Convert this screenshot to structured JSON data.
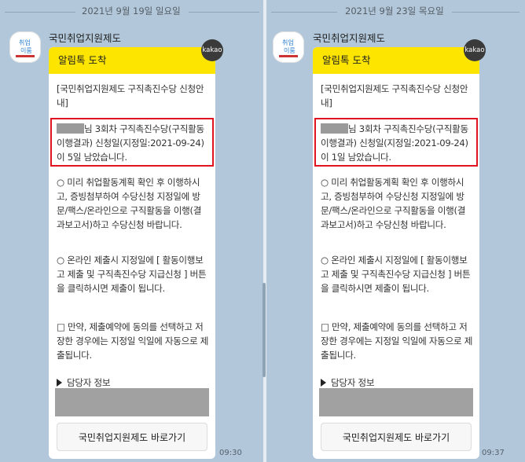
{
  "left": {
    "date": "2021년 9월 19일 일요일",
    "sender": "국민취업지원제도",
    "header": "알림톡 도착",
    "badge": "kakao",
    "intro": "[국민취업지원제도 구직촉진수당 신청안내]",
    "notice_suffix": "님 3회차 구직촉진수당(구직활동이행결과) 신청일(지정일:2021-09-24)이 5일 남았습니다.",
    "para1": "○ 미리 취업활동계획 확인 후 이행하시고, 증빙첨부하여 수당신청 지정일에 방문/팩스/온라인으로  구직활동을 이행(결과보고서)하고 수당신청 바랍니다.",
    "para2": "○ 온라인 제출시 지정일에 [ 활동이행보고 제출 및 구직촉진수당 지급신청 ] 버튼을 클릭하시면 제출이 됩니다.",
    "para3": "□ 만약, 제출예약에 동의를 선택하고 저장한 경우에는 지정일 익일에 자동으로 제출됩니다.",
    "staff": "담당자 정보",
    "button": "국민취업지원제도 바로가기",
    "time": "09:30"
  },
  "right": {
    "date": "2021년 9월 23일 목요일",
    "sender": "국민취업지원제도",
    "header": "알림톡 도착",
    "badge": "kakao",
    "intro": "[국민취업지원제도 구직촉진수당 신청안내]",
    "notice_suffix": "님 3회차 구직촉진수당(구직활동이행결과) 신청일(지정일:2021-09-24)이 1일 남았습니다.",
    "para1": "○ 미리 취업활동계획 확인 후 이행하시고, 증빙첨부하여 수당신청 지정일에 방문/팩스/온라인으로  구직활동을 이행(결과보고서)하고 수당신청 바랍니다.",
    "para2": "○ 온라인 제출시 지정일에 [ 활동이행보고 제출 및 구직촉진수당 지급신청 ] 버튼을 클릭하시면 제출이 됩니다.",
    "para3": "□ 만약, 제출예약에 동의를 선택하고 저장한 경우에는 지정일 익일에 자동으로 제출됩니다.",
    "staff": "담당자 정보",
    "button": "국민취업지원제도 바로가기",
    "time": "09:37"
  },
  "colors": {
    "background": "#b2c7d9",
    "header_yellow": "#fee500",
    "highlight_red": "#e0141e"
  },
  "icons": {
    "avatar": "work-together-logo",
    "staff_marker": "triangle-right-icon"
  }
}
